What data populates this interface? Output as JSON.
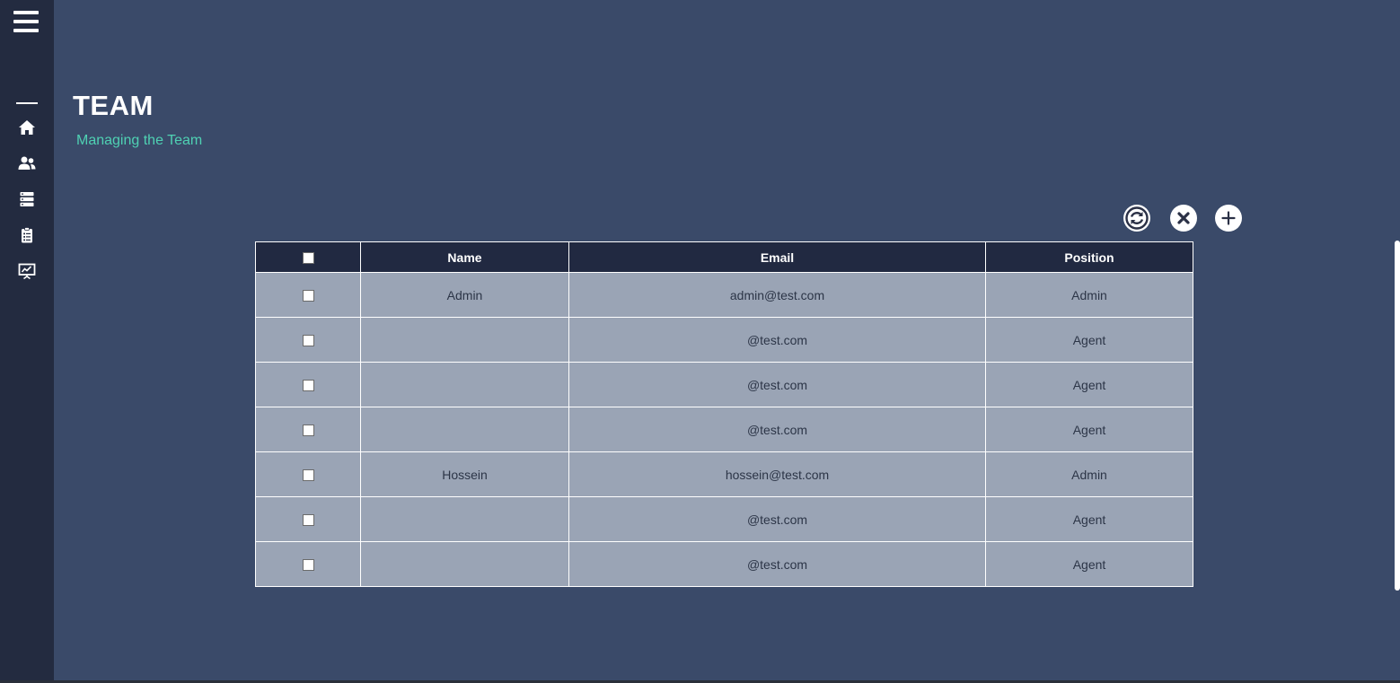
{
  "sidebar": {
    "items": [
      {
        "icon": "home-icon"
      },
      {
        "icon": "users-icon"
      },
      {
        "icon": "server-icon"
      },
      {
        "icon": "clipboard-icon"
      },
      {
        "icon": "presentation-icon"
      }
    ]
  },
  "page": {
    "title": "TEAM",
    "subtitle": "Managing the Team"
  },
  "actions": {
    "refresh": "refresh-icon",
    "delete": "close-icon",
    "add": "plus-icon"
  },
  "table": {
    "columns": [
      "",
      "Name",
      "Email",
      "Position"
    ],
    "rows": [
      {
        "name": "Admin",
        "email": "admin@test.com",
        "position": "Admin"
      },
      {
        "name": "",
        "email": "@test.com",
        "position": "Agent"
      },
      {
        "name": "",
        "email": "@test.com",
        "position": "Agent"
      },
      {
        "name": "",
        "email": "@test.com",
        "position": "Agent"
      },
      {
        "name": "Hossein",
        "email": "hossein@test.com",
        "position": "Admin"
      },
      {
        "name": "",
        "email": "@test.com",
        "position": "Agent"
      },
      {
        "name": "",
        "email": "@test.com",
        "position": "Agent"
      }
    ]
  },
  "colors": {
    "background": "#3a4a69",
    "sidebar": "#232b40",
    "header": "#212941",
    "row": "#9aa4b5",
    "accent": "#4fd1b3"
  }
}
